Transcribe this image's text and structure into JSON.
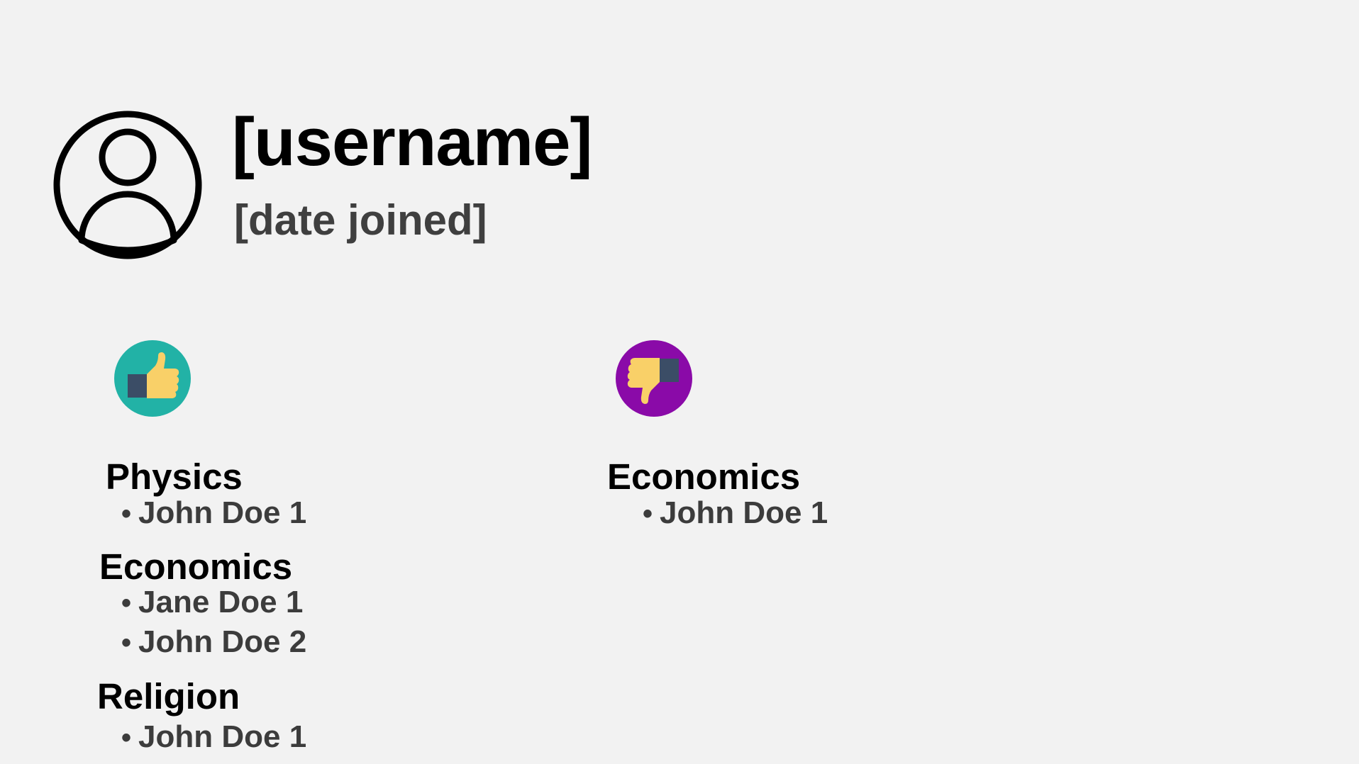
{
  "profile": {
    "username": "[username]",
    "date_joined": "[date joined]",
    "avatar_icon": "user-circle-icon"
  },
  "likes": {
    "icon": "thumbs-up-icon",
    "icon_bg": "#22b2a6",
    "groups": [
      {
        "topic": "Physics",
        "people": [
          "John Doe 1"
        ]
      },
      {
        "topic": "Economics",
        "people": [
          "Jane Doe 1",
          "John Doe 2"
        ]
      },
      {
        "topic": "Religion",
        "people": [
          "John Doe 1"
        ]
      }
    ]
  },
  "dislikes": {
    "icon": "thumbs-down-icon",
    "icon_bg": "#8a0aa8",
    "groups": [
      {
        "topic": "Economics",
        "people": [
          "John Doe 1"
        ]
      }
    ]
  },
  "bullet": "•"
}
